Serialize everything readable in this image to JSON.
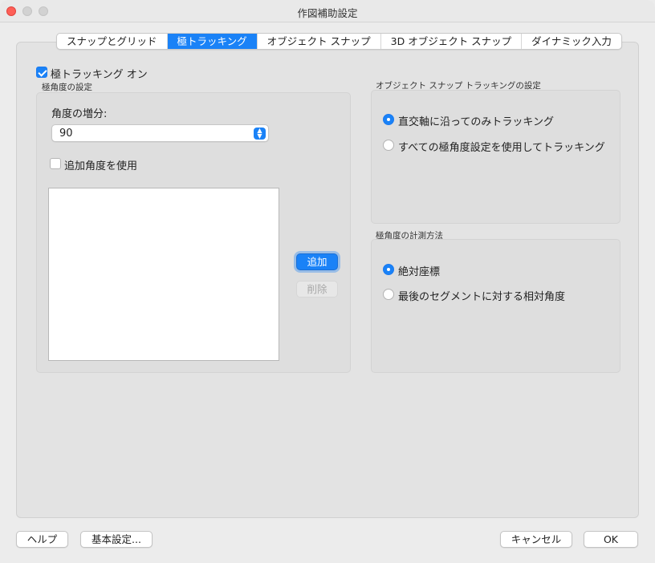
{
  "window": {
    "title": "作図補助設定"
  },
  "tabs": [
    {
      "label": "スナップとグリッド",
      "active": false
    },
    {
      "label": "極トラッキング",
      "active": true
    },
    {
      "label": "オブジェクト スナップ",
      "active": false
    },
    {
      "label": "3D オブジェクト スナップ",
      "active": false
    },
    {
      "label": "ダイナミック入力",
      "active": false
    }
  ],
  "polar": {
    "toggle_label": "極トラッキング オン",
    "toggle_checked": true,
    "group_title": "極角度の設定",
    "increment_label": "角度の増分:",
    "increment_value": "90",
    "additional_label": "追加角度を使用",
    "additional_checked": false,
    "add_button": "追加",
    "delete_button": "削除"
  },
  "osnap_tracking": {
    "group_title": "オブジェクト スナップ トラッキングの設定",
    "options": [
      {
        "label": "直交軸に沿ってのみトラッキング",
        "selected": true
      },
      {
        "label": "すべての極角度設定を使用してトラッキング",
        "selected": false
      }
    ]
  },
  "measurement": {
    "group_title": "極角度の計測方法",
    "options": [
      {
        "label": "絶対座標",
        "selected": true
      },
      {
        "label": "最後のセグメントに対する相対角度",
        "selected": false
      }
    ]
  },
  "footer": {
    "help": "ヘルプ",
    "options": "基本設定...",
    "cancel": "キャンセル",
    "ok": "OK"
  },
  "colors": {
    "accent": "#1a82f7",
    "close": "#fe5f57",
    "background": "#ececec"
  }
}
